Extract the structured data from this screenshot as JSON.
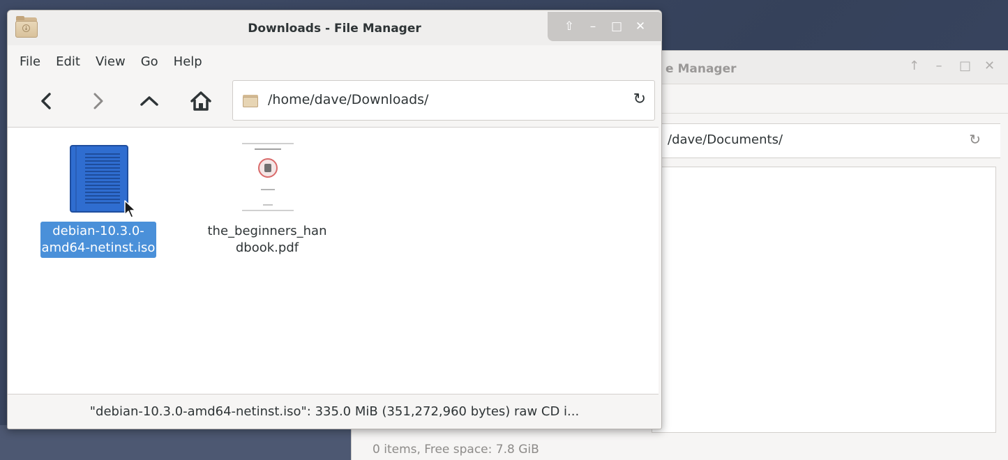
{
  "back_window": {
    "title_fragment": "e Manager",
    "window_buttons": [
      "↑",
      "–",
      "□",
      "✕"
    ],
    "path": "/dave/Documents/",
    "reload_icon": "reload-icon",
    "status": "0 items, Free space: 7.8 GiB"
  },
  "front_window": {
    "title": "Downloads - File Manager",
    "window_buttons": {
      "shade": "⇧",
      "minimize": "–",
      "maximize": "□",
      "close": "✕"
    },
    "menu": [
      "File",
      "Edit",
      "View",
      "Go",
      "Help"
    ],
    "toolbar": {
      "back_icon": "back-arrow-icon",
      "forward_icon": "forward-arrow-icon",
      "up_icon": "up-arrow-icon",
      "home_icon": "home-icon"
    },
    "path": "/home/dave/Downloads/",
    "reload_glyph": "↻",
    "files": [
      {
        "label_line1": "debian-10.3.0-",
        "label_line2": "amd64-netinst.iso",
        "selected": true
      },
      {
        "label_line1": "the_beginners_han",
        "label_line2": "dbook.pdf",
        "selected": false
      }
    ],
    "status": "\"debian-10.3.0-amd64-netinst.iso\": 335.0 MiB (351,272,960 bytes) raw CD i..."
  },
  "colors": {
    "selection": "#4a90d9",
    "desktop": "#3a4660",
    "iso_icon": "#2f6dd0"
  }
}
